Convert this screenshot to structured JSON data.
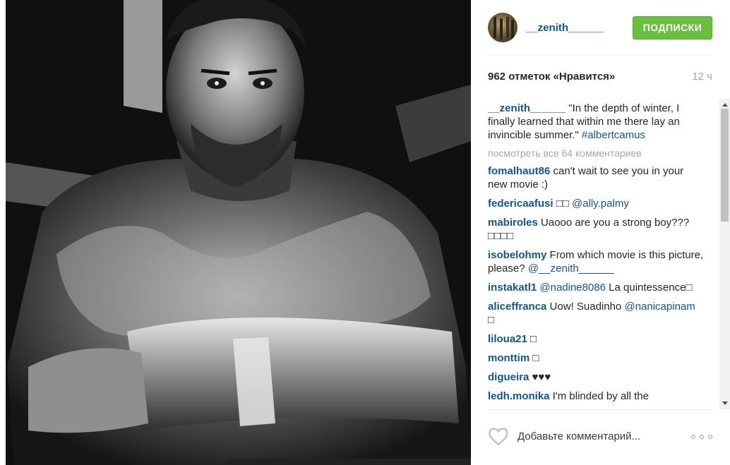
{
  "header": {
    "username": "__zenith______",
    "follow_label": "ПОДПИСКИ"
  },
  "post": {
    "likes": "962 отметок «Нравится»",
    "time": "12 ч"
  },
  "caption": {
    "user": "__zenith______",
    "text": " \"In the depth of winter, I finally learned that within me there lay an invincible summer.\" ",
    "hashtag": "#albertcamus"
  },
  "view_all": {
    "prefix": "посмотреть все ",
    "count": "64",
    "suffix": " комментариев"
  },
  "comments": [
    {
      "user": "fomalhaut86",
      "text": " can't wait to see you in your new movie :)",
      "mention": ""
    },
    {
      "user": "federicaafusi",
      "text": " □□ ",
      "mention": "@ally.palmy"
    },
    {
      "user": "mabiroles",
      "text": " Uaooo are you a strong boy???□□□□",
      "mention": ""
    },
    {
      "user": "isobelohmy",
      "text": " From which movie is this picture, please? ",
      "mention": "@__zenith______"
    },
    {
      "user": "instakatl1",
      "text": " La quintessence□",
      "mention": "@nadine8086",
      "mention_first": true
    },
    {
      "user": "aliceffranca",
      "text": " Uow! Suadinho ",
      "mention": "@nanicapinam",
      "after": " □"
    },
    {
      "user": "liloua21",
      "text": " □",
      "mention": ""
    },
    {
      "user": "monttim",
      "text": " □",
      "mention": ""
    },
    {
      "user": "digueira",
      "text": " ♥♥♥",
      "mention": ""
    },
    {
      "user": "ledh.monika",
      "text": " I'm blinded by all the",
      "mention": ""
    }
  ],
  "footer": {
    "comment_placeholder": "Добавьте комментарий...",
    "heart_icon": "heart-outline-icon",
    "more_icon": "more-options-icon"
  },
  "colors": {
    "link": "#125688",
    "follow_button": "#6bbf3e",
    "muted": "#a5a7aa"
  }
}
